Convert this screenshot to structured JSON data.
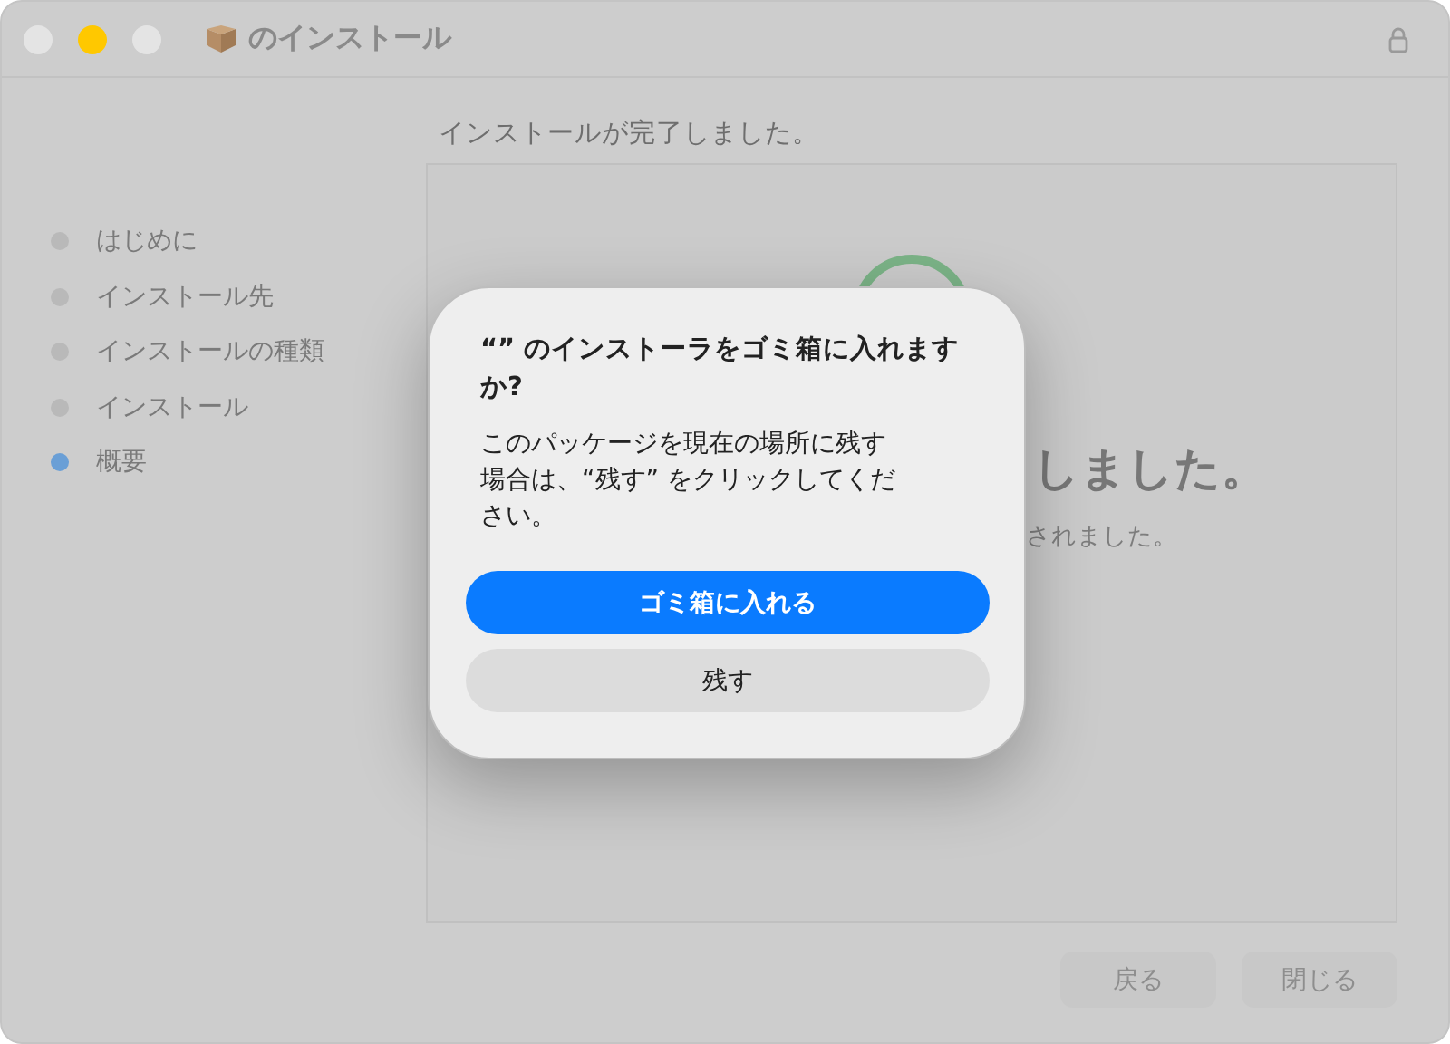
{
  "window": {
    "title": "のインストール",
    "traffic_lights": [
      {
        "color": "#e4e4e4"
      },
      {
        "color": "#ffc800"
      },
      {
        "color": "#e4e4e4"
      }
    ]
  },
  "heading": "インストールが完了しました。",
  "steps": [
    {
      "label": "はじめに",
      "selected": false
    },
    {
      "label": "インストール先",
      "selected": false
    },
    {
      "label": "インストールの種類",
      "selected": false
    },
    {
      "label": "インストール",
      "selected": false
    },
    {
      "label": "概要",
      "selected": true
    }
  ],
  "content": {
    "headline": "しました。",
    "subtext": "されました。"
  },
  "buttons": [
    {
      "label": "戻る",
      "disabled": true
    },
    {
      "label": "閉じる",
      "disabled": true
    }
  ],
  "dialog": {
    "title": "“” のインストーラをゴミ箱に入れますか?",
    "message": "このパッケージを現在の場所に残す場合は、“残す” をクリックしてください。",
    "buttons": [
      {
        "label": "ゴミ箱に入れる",
        "kind": "primary"
      },
      {
        "label": "残す",
        "kind": "secondary"
      }
    ]
  }
}
